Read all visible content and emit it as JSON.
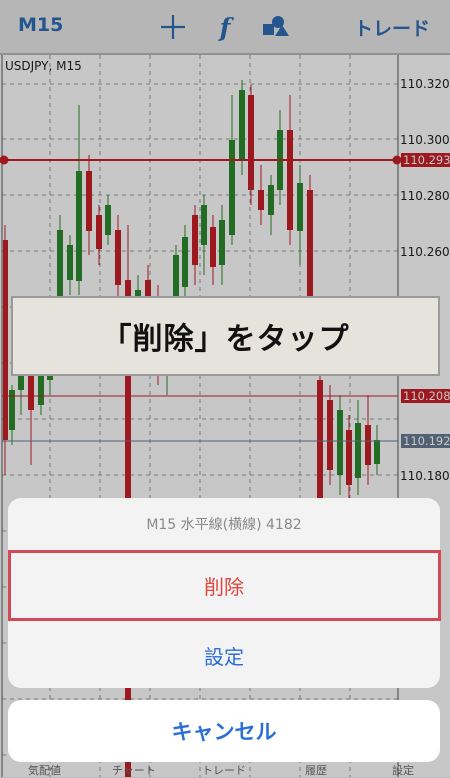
{
  "toolbar": {
    "title": "M15",
    "icons": [
      "crosshair-icon",
      "function-icon",
      "objects-icon"
    ],
    "trade_label": "トレード",
    "accent": "#2f6fb5"
  },
  "chart": {
    "symbol_label": "USDJPY, M15",
    "price_labels": [
      "110.320",
      "110.300",
      "110.280",
      "110.260",
      "110.180"
    ],
    "tags": [
      {
        "value": "110.293",
        "color": "#c8202a"
      },
      {
        "value": "110.208",
        "color": "#c8202a"
      },
      {
        "value": "110.192",
        "color": "#6a7d92"
      }
    ],
    "colors": {
      "bull": "#2e8b2e",
      "bear": "#c8202a",
      "grid": "#9a9a9a",
      "hline": "#c8202a"
    }
  },
  "callout": {
    "text": "「削除」をタップ"
  },
  "action_sheet": {
    "header": "M15 水平線(横線) 4182",
    "delete_label": "削除",
    "delete_color": "#e0463e",
    "settings_label": "設定",
    "settings_color": "#2a6fd6",
    "cancel_label": "キャンセル"
  },
  "tabbar": {
    "items": [
      "気配値",
      "チャート",
      "トレード",
      "履歴",
      "設定"
    ]
  }
}
